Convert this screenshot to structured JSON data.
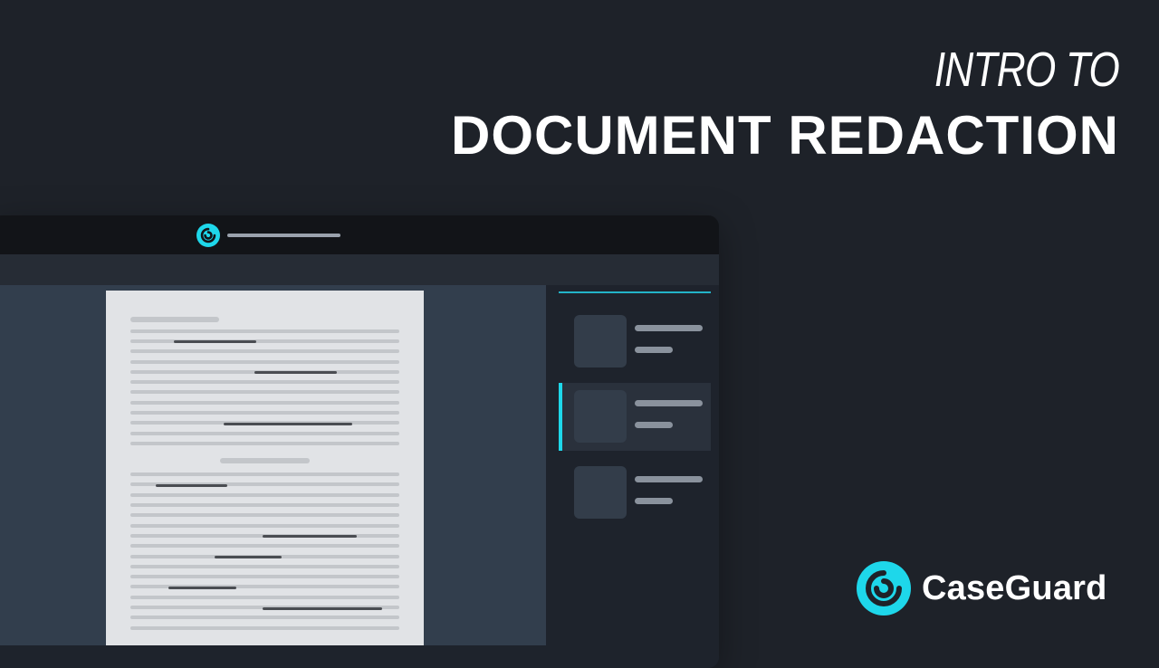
{
  "hero": {
    "eyebrow": "INTRO TO",
    "title": "DOCUMENT REDACTION"
  },
  "brand": {
    "name": "CaseGuard",
    "logo_icon": "caseguard-swirl-logo-icon",
    "accent_color": "#1ed7ea"
  },
  "app_window": {
    "titlebar_icon": "caseguard-swirl-logo-icon",
    "sidebar_cards": [
      {
        "state": "normal"
      },
      {
        "state": "selected"
      },
      {
        "state": "normal"
      }
    ]
  }
}
